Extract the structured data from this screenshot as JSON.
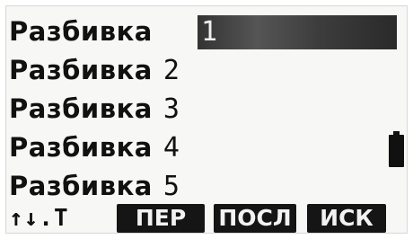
{
  "menu": {
    "items": [
      {
        "label": "Разбивка",
        "number": "1",
        "selected": true
      },
      {
        "label": "Разбивка",
        "number": "2",
        "selected": false
      },
      {
        "label": "Разбивка",
        "number": "3",
        "selected": false
      },
      {
        "label": "Разбивка",
        "number": "4",
        "selected": false
      },
      {
        "label": "Разбивка",
        "number": "5",
        "selected": false
      }
    ]
  },
  "status": {
    "battery_icon": "battery-icon"
  },
  "footer": {
    "nav_hint": "↑↓.T",
    "softkeys": [
      "ПЕР",
      "ПОСЛ",
      "ИСК"
    ]
  },
  "colors": {
    "background": "#f7f7f5",
    "text": "#111111",
    "selection": "#333333",
    "softkey_bg": "#151515",
    "softkey_text": "#f2f2f2"
  }
}
